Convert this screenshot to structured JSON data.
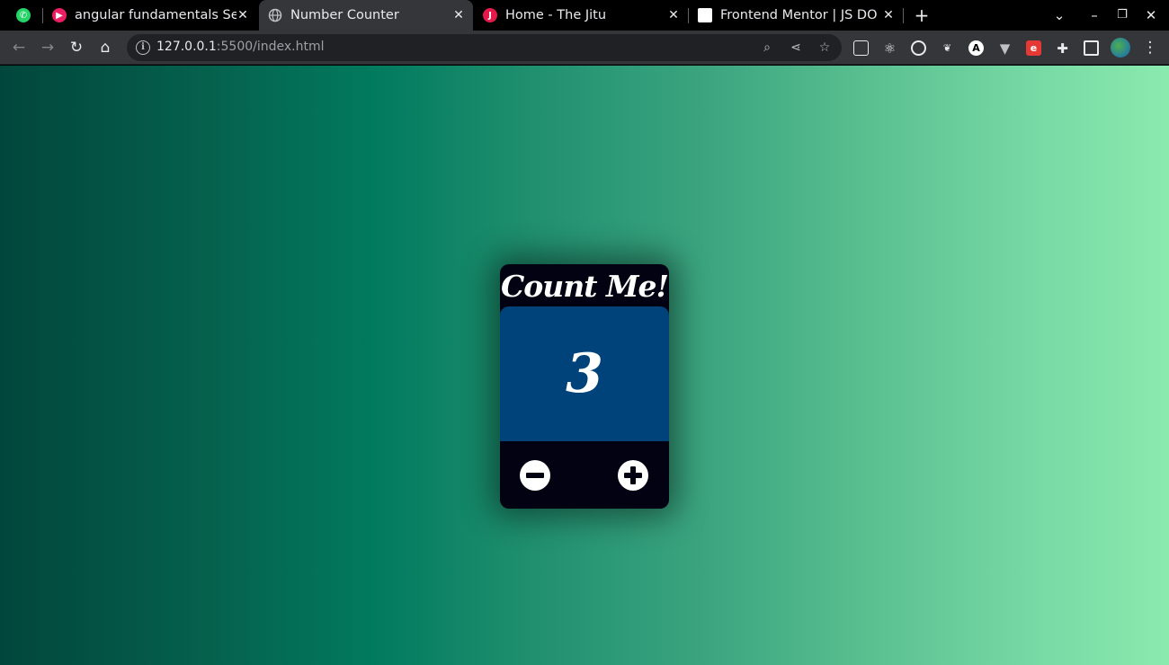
{
  "browser": {
    "tabs": [
      {
        "title": "",
        "favicon": "whatsapp-icon",
        "color": "#25d366"
      },
      {
        "title": "angular fundamentals Sea",
        "favicon": "youtube-music-icon",
        "color": "#e91e63"
      },
      {
        "title": "Number Counter",
        "favicon": "globe-icon",
        "color": "#bdc1c6",
        "active": true
      },
      {
        "title": "Home - The Jitu",
        "favicon": "jitu-icon",
        "color": "#e6194b"
      },
      {
        "title": "Frontend Mentor | JS DOM",
        "favicon": "frontend-mentor-icon",
        "color": "#ffffff"
      }
    ],
    "new_tab_label": "+",
    "address": {
      "host": "127.0.0.1",
      "rest": ":5500/index.html"
    }
  },
  "app": {
    "title": "Count Me!",
    "count": "3",
    "decrement_label": "−",
    "increment_label": "+"
  },
  "colors": {
    "page_gradient_start": "#01463c",
    "page_gradient_end": "#8aeaae",
    "card": "#020212",
    "display": "#00427a"
  }
}
